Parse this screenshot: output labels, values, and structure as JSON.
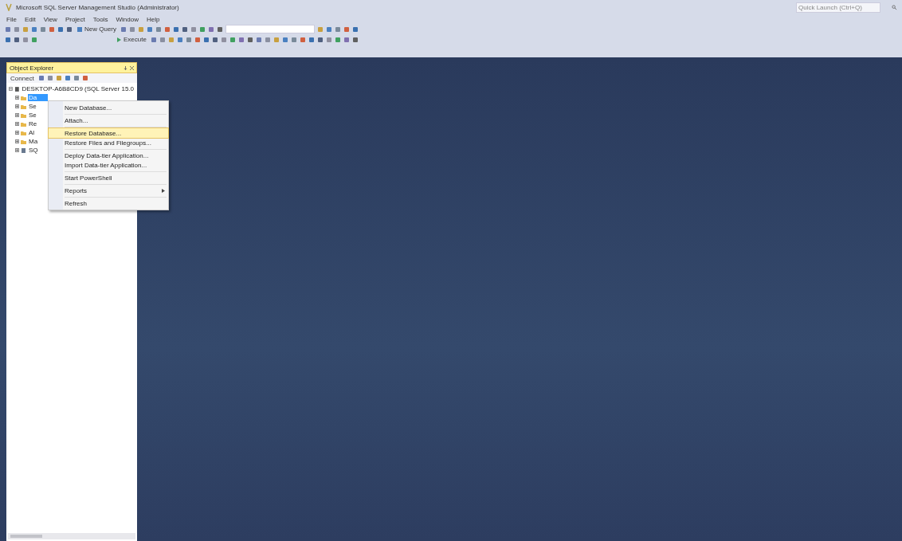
{
  "window": {
    "title": "Microsoft SQL Server Management Studio (Administrator)",
    "quick_launch": {
      "placeholder": "Quick Launch (Ctrl+Q)"
    }
  },
  "menu": [
    "File",
    "Edit",
    "View",
    "Project",
    "Tools",
    "Window",
    "Help"
  ],
  "toolbar": {
    "new_query": "New Query",
    "execute": "Execute"
  },
  "object_explorer": {
    "title": "Object Explorer",
    "connect": "Connect",
    "server": {
      "label": "DESKTOP-A6B8CD9 (SQL Server 15.0",
      "expanded": true
    },
    "nodes": [
      {
        "label": "Da",
        "selected": true,
        "kind": "folder"
      },
      {
        "label": "Se",
        "selected": false,
        "kind": "folder"
      },
      {
        "label": "Se",
        "selected": false,
        "kind": "folder"
      },
      {
        "label": "Re",
        "selected": false,
        "kind": "folder"
      },
      {
        "label": "Al",
        "selected": false,
        "kind": "folder"
      },
      {
        "label": "Ma",
        "selected": false,
        "kind": "folder"
      },
      {
        "label": "SQ",
        "selected": false,
        "kind": "agent"
      }
    ]
  },
  "context_menu": [
    {
      "kind": "item",
      "label": "New Database...",
      "selected": false,
      "submenu": false
    },
    {
      "kind": "separator"
    },
    {
      "kind": "item",
      "label": "Attach...",
      "selected": false,
      "submenu": false
    },
    {
      "kind": "separator"
    },
    {
      "kind": "item",
      "label": "Restore Database...",
      "selected": true,
      "submenu": false
    },
    {
      "kind": "item",
      "label": "Restore Files and Filegroups...",
      "selected": false,
      "submenu": false
    },
    {
      "kind": "separator"
    },
    {
      "kind": "item",
      "label": "Deploy Data-tier Application...",
      "selected": false,
      "submenu": false
    },
    {
      "kind": "item",
      "label": "Import Data-tier Application...",
      "selected": false,
      "submenu": false
    },
    {
      "kind": "separator"
    },
    {
      "kind": "item",
      "label": "Start PowerShell",
      "selected": false,
      "submenu": false
    },
    {
      "kind": "separator"
    },
    {
      "kind": "item",
      "label": "Reports",
      "selected": false,
      "submenu": true
    },
    {
      "kind": "separator"
    },
    {
      "kind": "item",
      "label": "Refresh",
      "selected": false,
      "submenu": false
    }
  ]
}
